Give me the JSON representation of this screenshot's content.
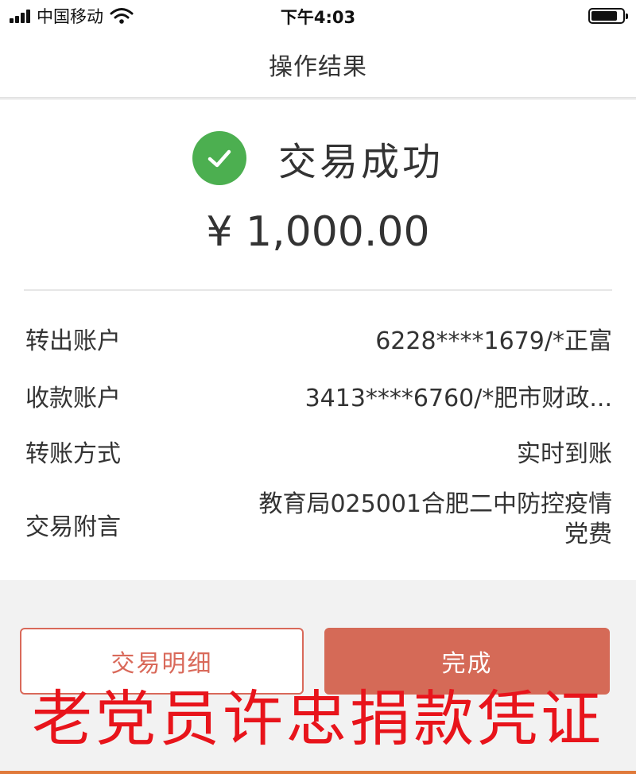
{
  "status_bar": {
    "carrier": "中国移动",
    "time": "下午4:03",
    "battery_level": 0.85,
    "icons": [
      "signal-icon",
      "wifi-icon",
      "battery-icon"
    ]
  },
  "nav": {
    "title": "操作结果"
  },
  "result": {
    "status_text": "交易成功",
    "status_icon": "check-circle-icon",
    "status_color": "#4caf50",
    "amount": "¥ 1,000.00"
  },
  "details": [
    {
      "label": "转出账户",
      "value": "6228****1679/*正富"
    },
    {
      "label": "收款账户",
      "value": "3413****6760/*肥市财政..."
    },
    {
      "label": "转账方式",
      "value": "实时到账"
    },
    {
      "label": "交易附言",
      "value_line1": "教育局025001合肥二中防控疫情",
      "value_line2": "党费"
    }
  ],
  "buttons": {
    "detail_label": "交易明细",
    "done_label": "完成",
    "accent_color": "#d56a57"
  },
  "overlay": {
    "caption": "老党员许忠捐款凭证",
    "color": "#e8141b"
  }
}
